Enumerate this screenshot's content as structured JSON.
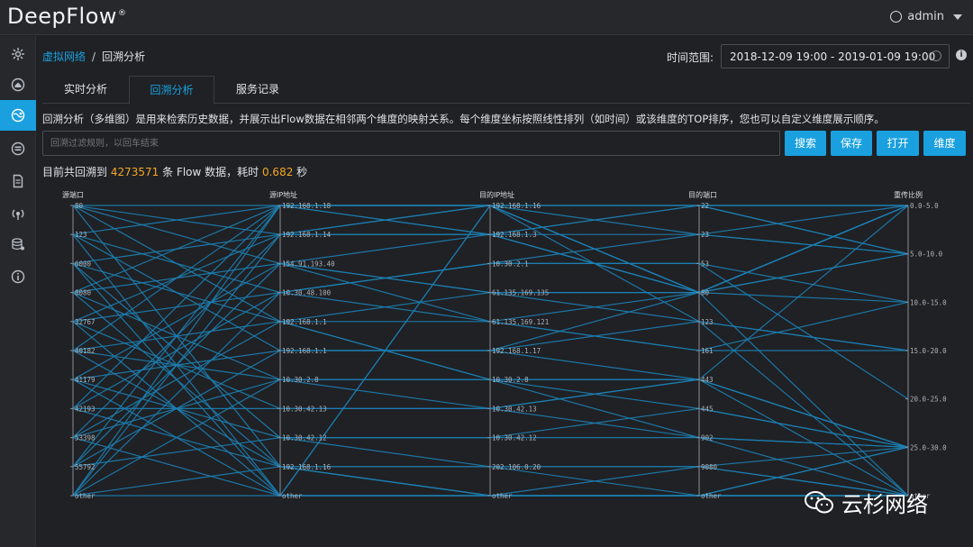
{
  "app": {
    "logo_text": "DeepFlow",
    "logo_mark": "®"
  },
  "user": {
    "name": "admin"
  },
  "sidebar": {
    "items": [
      {
        "name": "dashboard-icon",
        "active": false
      },
      {
        "name": "home-icon",
        "active": false
      },
      {
        "name": "globe-network-icon",
        "active": true
      },
      {
        "name": "stack-icon",
        "active": false
      },
      {
        "name": "document-icon",
        "active": false
      },
      {
        "name": "broadcast-icon",
        "active": false
      },
      {
        "name": "database-icon",
        "active": false
      },
      {
        "name": "info-icon",
        "active": false
      }
    ]
  },
  "breadcrumb": {
    "parent": "虚拟网络",
    "separator": "/",
    "current": "回溯分析"
  },
  "time": {
    "label": "时间范围:",
    "value": "2018-12-09 19:00 - 2019-01-09 19:00"
  },
  "tabs": [
    {
      "label": "实时分析",
      "active": false
    },
    {
      "label": "回溯分析",
      "active": true
    },
    {
      "label": "服务记录",
      "active": false
    }
  ],
  "description": "回溯分析（多维图）是用来检索历史数据，并展示出Flow数据在相邻两个维度的映射关系。每个维度坐标按照线性排列（如时间）或该维度的TOP排序，您也可以自定义维度展示顺序。",
  "search": {
    "placeholder": "回溯过滤规则，以回车结束"
  },
  "buttons": {
    "search": "搜索",
    "save": "保存",
    "open": "打开",
    "dimension": "维度"
  },
  "summary": {
    "prefix": "目前共回溯到",
    "count": "4273571",
    "middle": "条 Flow 数据，耗时",
    "time": "0.682",
    "suffix": "秒"
  },
  "colors": {
    "accent": "#1aa0df",
    "highlight": "#f5a623",
    "line": "#1d7fb3"
  },
  "chart_data": {
    "type": "parallel-coordinates",
    "axes": [
      {
        "name": "源端口",
        "ticks": [
          "80",
          "123",
          "6000",
          "8080",
          "32767",
          "40182",
          "41179",
          "42193",
          "53398",
          "55792",
          "other"
        ]
      },
      {
        "name": "源IP地址",
        "ticks": [
          "192.168.1.18",
          "192.168.1.14",
          "154.91.193.40",
          "10.30.48.100",
          "192.168.1.1",
          "192.168.1.1",
          "10.30.2.8",
          "10.30.42.13",
          "10.30.42.12",
          "192.168.1.16",
          "other"
        ]
      },
      {
        "name": "目的IP地址",
        "ticks": [
          "192.168.1.16",
          "192.168.1.3",
          "10.30.2.1",
          "61.135.169.135",
          "61.135.169.121",
          "192.168.1.17",
          "10.30.2.8",
          "10.30.42.13",
          "10.30.42.12",
          "202.106.0.20",
          "other"
        ]
      },
      {
        "name": "目的端口",
        "ticks": [
          "22",
          "23",
          "53",
          "80",
          "123",
          "161",
          "443",
          "445",
          "902",
          "9080",
          "other"
        ]
      },
      {
        "name": "重传比例",
        "ticks": [
          "0.0-5.0",
          "5.0-10.0",
          "10.0-15.0",
          "15.0-20.0",
          "20.0-25.0",
          "25.0-30.0",
          "other"
        ]
      }
    ],
    "records": [
      [
        0,
        0,
        0,
        3,
        0
      ],
      [
        0,
        1,
        1,
        0,
        1
      ],
      [
        0,
        2,
        3,
        3,
        6
      ],
      [
        0,
        4,
        6,
        6,
        0
      ],
      [
        0,
        9,
        10,
        10,
        5
      ],
      [
        1,
        0,
        0,
        0,
        0
      ],
      [
        1,
        3,
        2,
        2,
        2
      ],
      [
        1,
        5,
        5,
        4,
        6
      ],
      [
        1,
        10,
        10,
        10,
        5
      ],
      [
        2,
        1,
        1,
        3,
        0
      ],
      [
        2,
        4,
        6,
        6,
        6
      ],
      [
        2,
        8,
        8,
        7,
        5
      ],
      [
        2,
        10,
        0,
        0,
        1
      ],
      [
        3,
        0,
        1,
        3,
        0
      ],
      [
        3,
        2,
        4,
        5,
        3
      ],
      [
        3,
        6,
        6,
        8,
        5
      ],
      [
        3,
        9,
        9,
        9,
        6
      ],
      [
        4,
        1,
        0,
        3,
        0
      ],
      [
        4,
        3,
        2,
        1,
        1
      ],
      [
        4,
        7,
        7,
        6,
        5
      ],
      [
        4,
        10,
        10,
        10,
        6
      ],
      [
        5,
        0,
        0,
        4,
        3
      ],
      [
        5,
        4,
        3,
        3,
        2
      ],
      [
        5,
        6,
        6,
        6,
        5
      ],
      [
        5,
        9,
        9,
        10,
        6
      ],
      [
        6,
        2,
        1,
        0,
        0
      ],
      [
        6,
        5,
        5,
        3,
        1
      ],
      [
        6,
        8,
        8,
        8,
        6
      ],
      [
        6,
        10,
        10,
        9,
        5
      ],
      [
        7,
        0,
        0,
        3,
        0
      ],
      [
        7,
        3,
        2,
        2,
        4
      ],
      [
        7,
        7,
        7,
        6,
        5
      ],
      [
        7,
        9,
        10,
        10,
        6
      ],
      [
        8,
        1,
        1,
        1,
        0
      ],
      [
        8,
        4,
        4,
        3,
        1
      ],
      [
        8,
        6,
        6,
        7,
        5
      ],
      [
        8,
        10,
        10,
        10,
        6
      ],
      [
        9,
        0,
        0,
        0,
        0
      ],
      [
        9,
        2,
        3,
        4,
        3
      ],
      [
        9,
        5,
        5,
        6,
        5
      ],
      [
        9,
        8,
        9,
        9,
        6
      ],
      [
        10,
        0,
        1,
        3,
        0
      ],
      [
        10,
        1,
        0,
        1,
        1
      ],
      [
        10,
        3,
        4,
        5,
        2
      ],
      [
        10,
        6,
        7,
        8,
        5
      ],
      [
        10,
        9,
        10,
        10,
        6
      ],
      [
        10,
        10,
        0,
        3,
        0
      ]
    ]
  },
  "watermark": {
    "text": "云杉网络"
  }
}
